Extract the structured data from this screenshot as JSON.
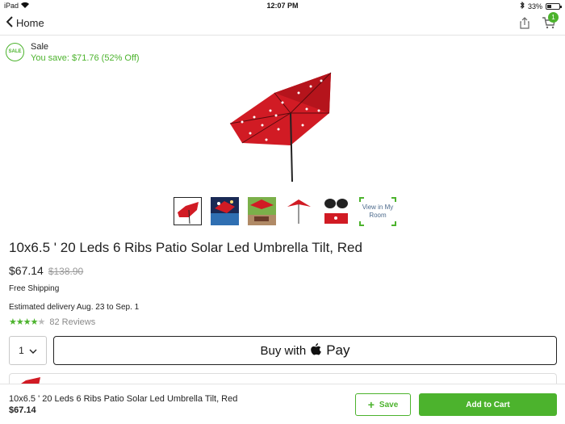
{
  "status_bar": {
    "device": "iPad",
    "time": "12:07 PM",
    "battery_percent": "33%",
    "battery_level": 0.33
  },
  "nav": {
    "back_label": "Home",
    "cart_count": "1"
  },
  "sale": {
    "badge": "SALE",
    "label": "Sale",
    "savings": "You save: $71.76 (52% Off)"
  },
  "gallery": {
    "thumbnails": [
      "umbrella-lit",
      "pool-umbrella",
      "patio-umbrella",
      "umbrella-side",
      "solar-panel"
    ],
    "view_in_room": "View in My Room"
  },
  "product": {
    "title": "10x6.5 ' 20 Leds 6 Ribs Patio Solar Led Umbrella Tilt, Red",
    "price": "$67.14",
    "was_price": "$138.90",
    "shipping": "Free Shipping",
    "delivery": "Estimated delivery Aug. 23 to Sep. 1",
    "rating": 4,
    "rating_max": 5,
    "reviews": "82 Reviews"
  },
  "purchase": {
    "quantity": "1",
    "applepay_prefix": "Buy with",
    "applepay_brand": "Pay"
  },
  "bottom_bar": {
    "title": "10x6.5 ' 20 Leds 6 Ribs Patio Solar Led Umbrella Tilt, Red",
    "price": "$67.14",
    "save_label": "Save",
    "add_to_cart_label": "Add to Cart"
  },
  "colors": {
    "accent": "#4cb32d",
    "umbrella": "#d11b24"
  }
}
